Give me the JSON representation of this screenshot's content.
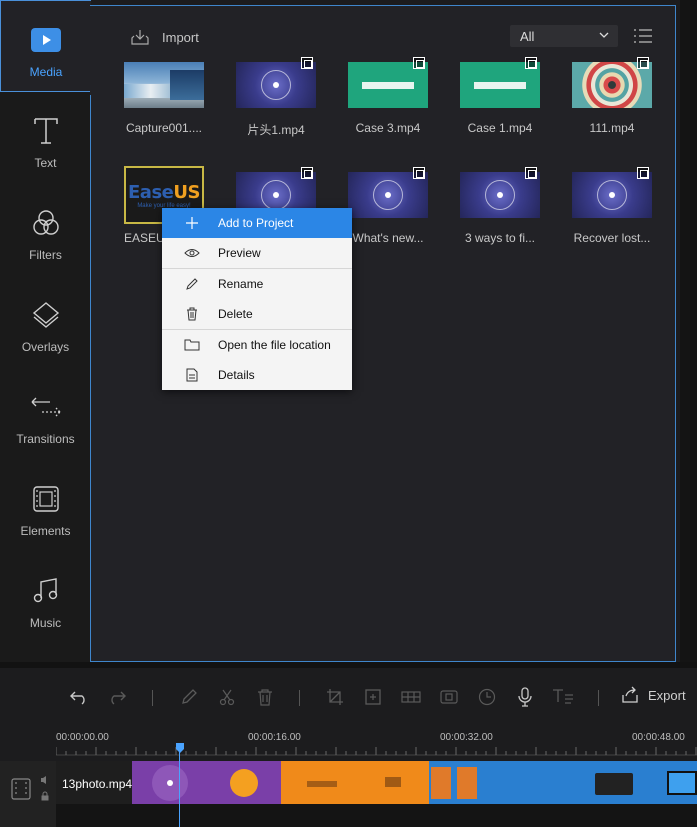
{
  "sidebar": {
    "items": [
      {
        "label": "Media",
        "icon": "media-icon",
        "active": true
      },
      {
        "label": "Text",
        "icon": "text-icon"
      },
      {
        "label": "Filters",
        "icon": "filters-icon"
      },
      {
        "label": "Overlays",
        "icon": "overlays-icon"
      },
      {
        "label": "Transitions",
        "icon": "transitions-icon"
      },
      {
        "label": "Elements",
        "icon": "elements-icon"
      },
      {
        "label": "Music",
        "icon": "music-icon"
      }
    ]
  },
  "media": {
    "import_label": "Import",
    "filter": {
      "selected": "All"
    },
    "row1": [
      {
        "label": "Capture001....",
        "kind": "capture"
      },
      {
        "label": "片头1.mp4",
        "kind": "purple",
        "badge": true
      },
      {
        "label": "Case 3.mp4",
        "kind": "teal",
        "badge": true
      },
      {
        "label": "Case 1.mp4",
        "kind": "teal",
        "badge": true
      },
      {
        "label": "111.mp4",
        "kind": "rings",
        "badge": true
      }
    ],
    "row2": [
      {
        "label": "EASEU",
        "kind": "easeus"
      },
      {
        "label": "",
        "kind": "purple",
        "badge": true
      },
      {
        "label": "What's new...",
        "kind": "purple",
        "badge": true
      },
      {
        "label": "3 ways to fi...",
        "kind": "purple",
        "badge": true
      },
      {
        "label": "Recover lost...",
        "kind": "purple",
        "badge": true
      }
    ],
    "easeus_logo": {
      "text_a": "Ease",
      "text_b": "US",
      "tagline": "Make your life easy!"
    }
  },
  "context_menu": {
    "items": [
      {
        "label": "Add to Project",
        "icon": "plus-icon",
        "highlighted": true
      },
      {
        "label": "Preview",
        "icon": "eye-icon"
      },
      {
        "label": "Rename",
        "icon": "pencil-icon"
      },
      {
        "label": "Delete",
        "icon": "trash-icon"
      },
      {
        "label": "Open the file location",
        "icon": "folder-icon"
      },
      {
        "label": "Details",
        "icon": "details-icon"
      }
    ]
  },
  "timeline": {
    "export_label": "Export",
    "ruler": [
      "00:00:00.00",
      "00:00:16.00",
      "00:00:32.00",
      "00:00:48.00"
    ],
    "track_clip_label": "13photo.mp4"
  },
  "colors": {
    "accent": "#4aa3ff",
    "highlight": "#2b86e6"
  }
}
